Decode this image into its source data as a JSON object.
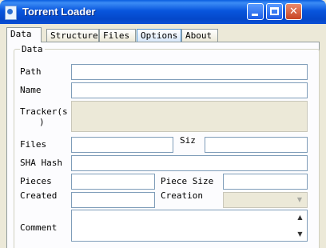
{
  "window": {
    "title": "Torrent Loader"
  },
  "tabs": [
    "Data",
    "Structure",
    "Files",
    "Options",
    "About"
  ],
  "group": {
    "legend": "Data"
  },
  "fields": {
    "path": "Path",
    "name": "Name",
    "tracker_line1": "Tracker(s",
    "tracker_line2": ")",
    "files": "Files",
    "size": "Siz",
    "sha_hash": "SHA Hash",
    "pieces": "Pieces",
    "piece_size": "Piece Size",
    "created": "Created",
    "creation": "Creation",
    "comment": "Comment"
  },
  "icons": {
    "dropdown": "chevron-down-icon",
    "scroll_up": "scroll-up-icon",
    "scroll_down": "scroll-down-icon"
  }
}
